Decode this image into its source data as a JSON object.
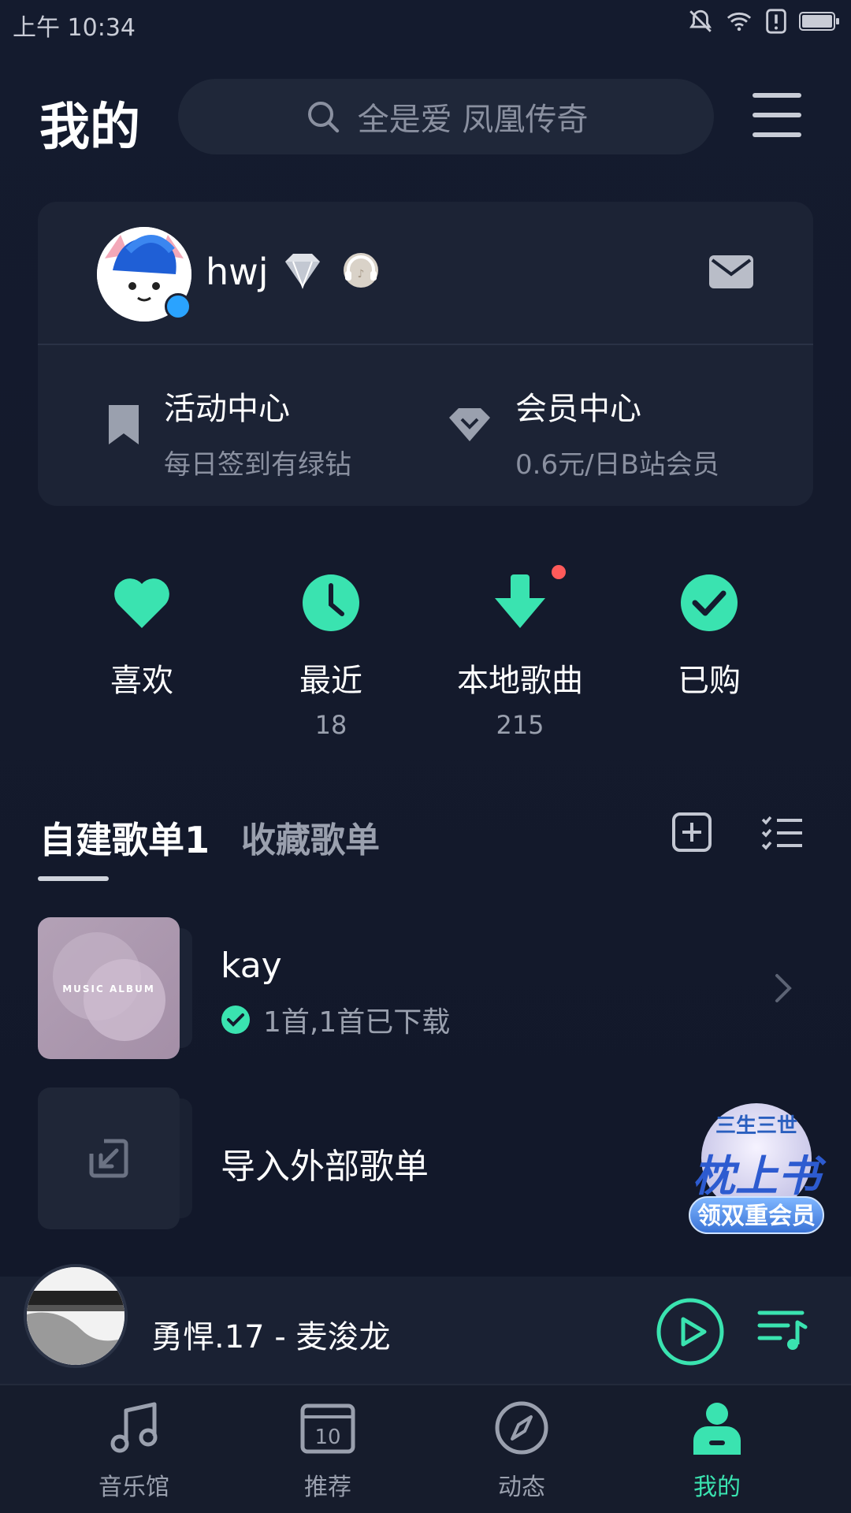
{
  "status_bar": {
    "time": "上午 10:34"
  },
  "header": {
    "title": "我的",
    "search_placeholder": "全是爱 凤凰传奇"
  },
  "profile": {
    "username": "hwj"
  },
  "activities": [
    {
      "title": "活动中心",
      "subtitle": "每日签到有绿钻"
    },
    {
      "title": "会员中心",
      "subtitle": "0.6元/日B站会员"
    }
  ],
  "quick_actions": [
    {
      "label": "喜欢",
      "count": ""
    },
    {
      "label": "最近",
      "count": "18"
    },
    {
      "label": "本地歌曲",
      "count": "215"
    },
    {
      "label": "已购",
      "count": ""
    }
  ],
  "playlist_tabs": {
    "created": "自建歌单1",
    "collected": "收藏歌单"
  },
  "playlists": [
    {
      "cover_text": "MUSIC ALBUM",
      "name": "kay",
      "meta": "1首,1首已下载"
    }
  ],
  "import": {
    "label": "导入外部歌单"
  },
  "promo": {
    "title": "三生三世",
    "name": "枕上书",
    "cta": "领双重会员"
  },
  "player": {
    "song": "勇悍.17 - 麦浚龙"
  },
  "bottom_nav": [
    {
      "label": "音乐馆"
    },
    {
      "label": "推荐",
      "badge": "10"
    },
    {
      "label": "动态"
    },
    {
      "label": "我的"
    }
  ],
  "colors": {
    "accent": "#3ae3b0",
    "background": "#141b2e",
    "card": "#1c2335",
    "notification": "#ff5a5a"
  }
}
